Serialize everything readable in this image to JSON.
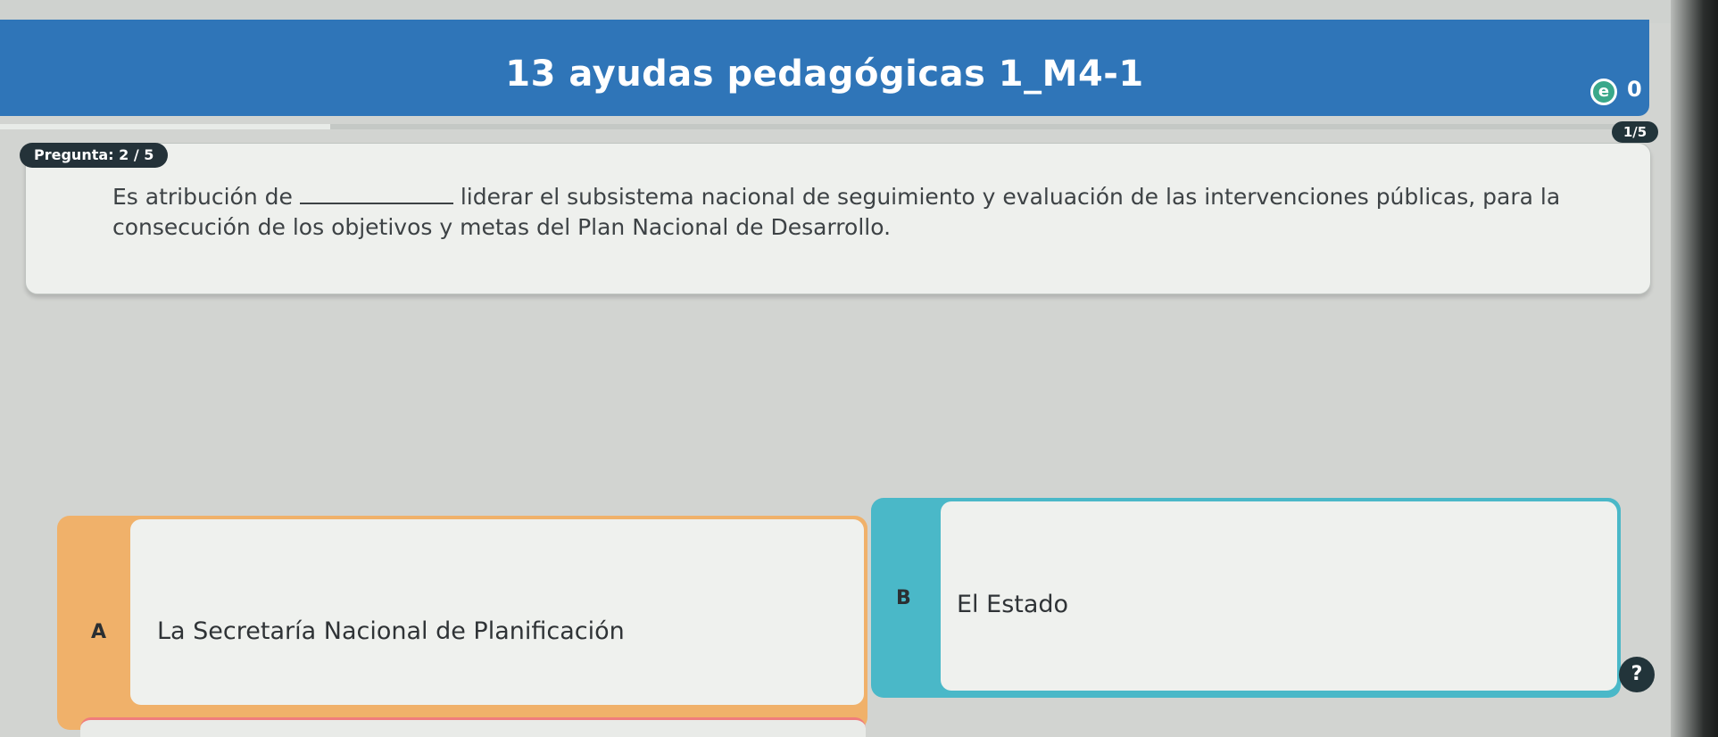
{
  "header": {
    "title": "13 ayudas pedagógicas 1_M4-1",
    "coin_icon_glyph": "e",
    "score": "0"
  },
  "progress": {
    "step_label": "1/5",
    "fraction": 0.2
  },
  "question": {
    "badge": "Pregunta: 2 / 5",
    "text_before": "Es atribución de",
    "text_after": "liderar el subsistema nacional de seguimiento y evaluación de las intervenciones públicas, para la consecución de los objetivos y metas del Plan Nacional de Desarrollo."
  },
  "options": [
    {
      "letter": "A",
      "label": "La Secretaría Nacional de Planificación",
      "accent": "#f0b16a"
    },
    {
      "letter": "B",
      "label": "El Estado",
      "accent": "#4ab8c8"
    }
  ],
  "help": {
    "glyph": "?"
  },
  "colors": {
    "header_bg": "#2f75b8",
    "badge_bg": "#243239",
    "option_a_accent": "#f0b16a",
    "option_b_accent": "#4ab8c8"
  }
}
